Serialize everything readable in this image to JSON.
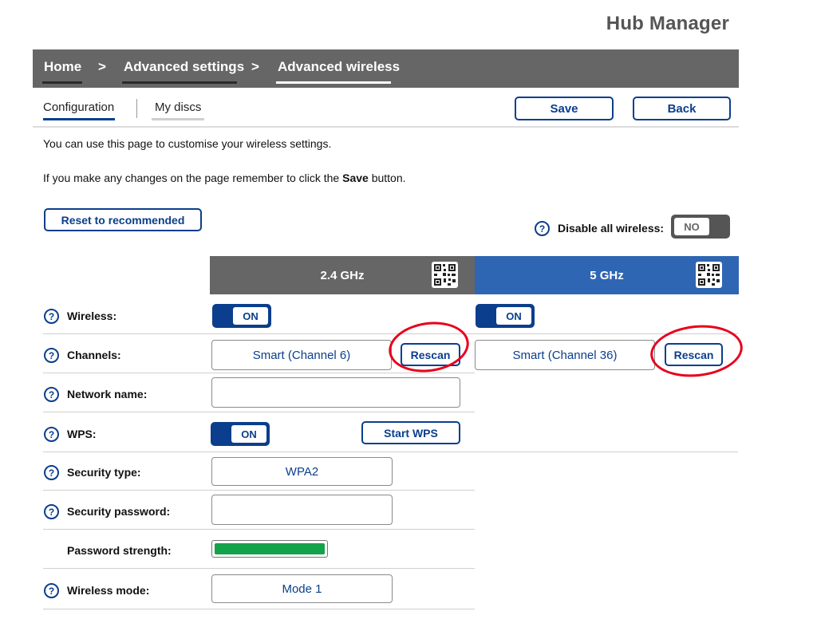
{
  "app": {
    "title": "Hub Manager"
  },
  "breadcrumb": {
    "home": "Home",
    "advanced": "Advanced settings",
    "current": "Advanced wireless",
    "separator": ">"
  },
  "tabs": [
    {
      "label": "Configuration"
    },
    {
      "label": "My discs"
    }
  ],
  "toolbar": {
    "save_label": "Save",
    "back_label": "Back"
  },
  "intro": {
    "line1": "You can use this page to customise your wireless settings.",
    "line2_before": "If you make any changes on the page remember to click the ",
    "line2_bold": "Save",
    "line2_after": " button."
  },
  "reset_label": "Reset to recommended",
  "disable_all": {
    "label": "Disable all wireless:",
    "value": "NO"
  },
  "help_glyph": "?",
  "bands": {
    "b24": "2.4 GHz",
    "b5": "5 GHz"
  },
  "rows": {
    "wireless": "Wireless:",
    "channels": "Channels:",
    "network_name": "Network name:",
    "wps": "WPS:",
    "security_type": "Security type:",
    "security_password": "Security password:",
    "password_strength": "Password strength:",
    "wireless_mode": "Wireless mode:"
  },
  "values": {
    "wireless_24": "ON",
    "wireless_5": "ON",
    "channel_24": "Smart (Channel 6)",
    "channel_5": "Smart (Channel 36)",
    "rescan": "Rescan",
    "network_name": "",
    "wps": "ON",
    "start_wps": "Start WPS",
    "security_type": "WPA2",
    "security_password": "",
    "password_strength_percent": 100,
    "wireless_mode": "Mode 1"
  },
  "colors": {
    "brand_blue": "#0b3e8c",
    "band_24": "#666666",
    "band_5": "#2f66b3",
    "highlight_red": "#e8001c",
    "strength_green": "#14a24a"
  },
  "icons": {
    "help": "help-circle-icon",
    "qr": "qr-code-icon"
  }
}
